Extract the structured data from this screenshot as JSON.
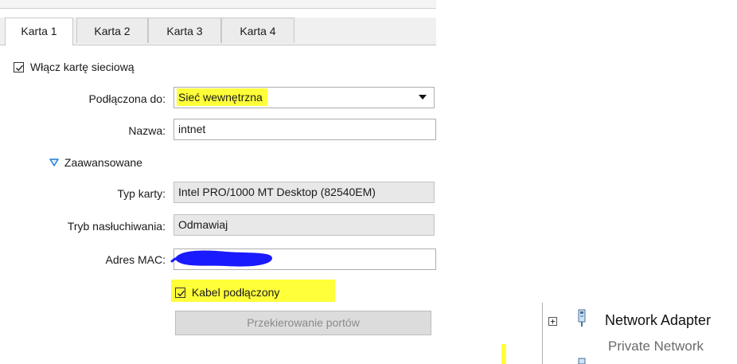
{
  "tabs": [
    {
      "label": "Karta 1",
      "active": true
    },
    {
      "label": "Karta 2",
      "active": false
    },
    {
      "label": "Karta 3",
      "active": false
    },
    {
      "label": "Karta 4",
      "active": false
    }
  ],
  "enable_adapter": {
    "label": "Włącz kartę sieciową",
    "checked": true
  },
  "attached_to": {
    "label": "Podłączona do:",
    "value": "Sieć wewnętrzna"
  },
  "name": {
    "label": "Nazwa:",
    "value": "intnet"
  },
  "advanced": {
    "label": "Zaawansowane"
  },
  "adapter_type": {
    "label": "Typ karty:",
    "value": "Intel PRO/1000 MT Desktop (82540EM)"
  },
  "promiscuous": {
    "label": "Tryb nasłuchiwania:",
    "value": "Odmawiaj"
  },
  "mac": {
    "label": "Adres MAC:",
    "value": ""
  },
  "cable": {
    "label": "Kabel podłączony",
    "checked": true
  },
  "port_forwarding": {
    "label": "Przekierowanie portów"
  },
  "tree": {
    "expand_glyph": "+",
    "title": "Network Adapter",
    "subtitle": "Private Network"
  },
  "colors": {
    "highlight": "#ffff3a",
    "mac_redaction": "#1a1aff"
  }
}
